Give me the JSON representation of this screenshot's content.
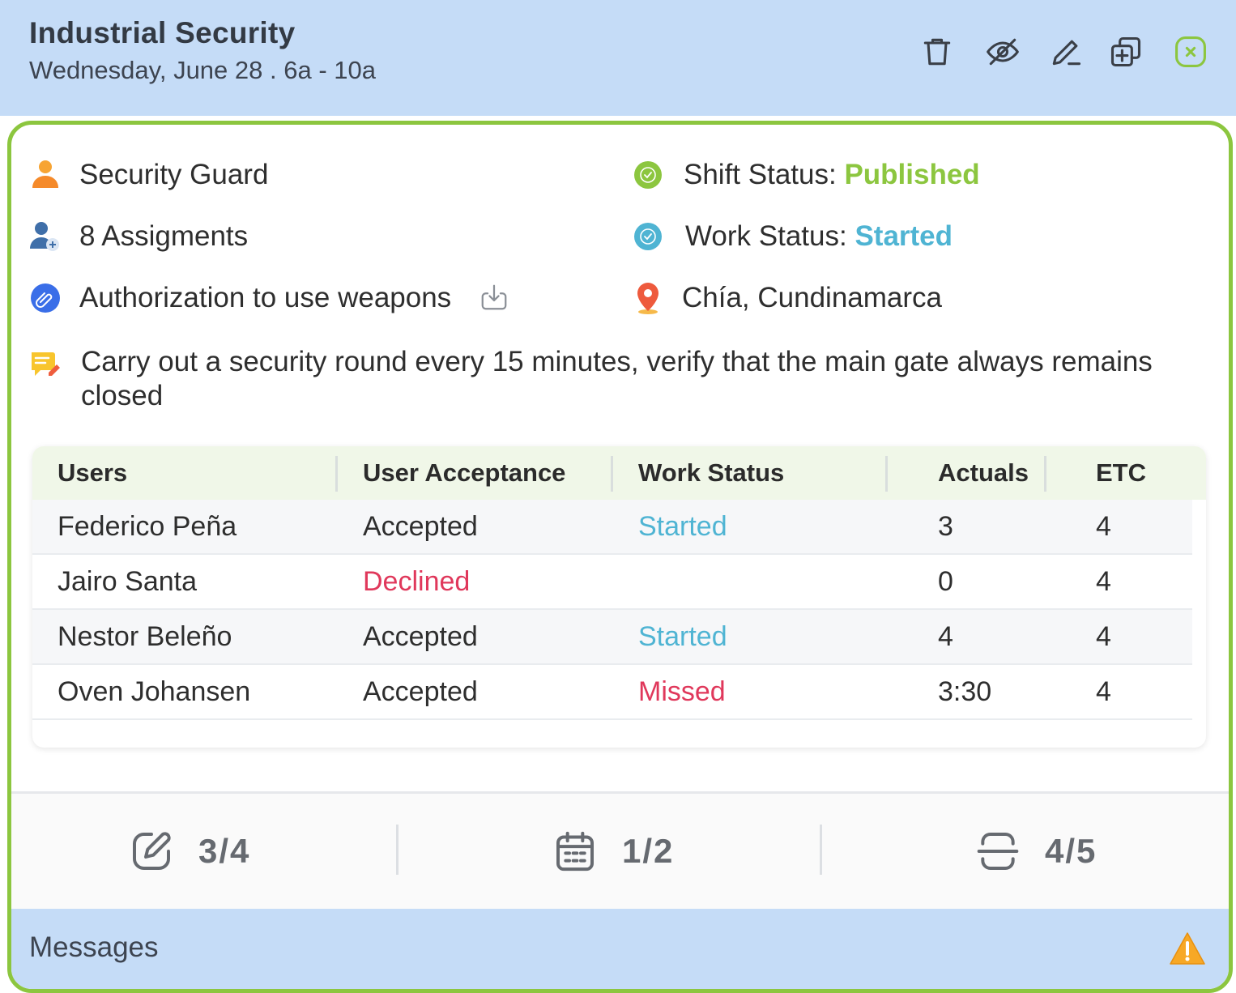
{
  "header": {
    "title": "Industrial Security",
    "subtitle": "Wednesday, June 28 . 6a - 10a",
    "actions": [
      "trash-icon",
      "eye-off-icon",
      "pencil-icon",
      "duplicate-icon",
      "close-icon"
    ]
  },
  "details": {
    "role": "Security Guard",
    "assignments": "8 Assigments",
    "attachment": "Authorization to use weapons",
    "shift_status_label": "Shift Status",
    "shift_status_value": "Published",
    "work_status_label": "Work Status",
    "work_status_value": "Started",
    "location": "Chía, Cundinamarca",
    "note": "Carry out a security round every 15 minutes, verify that the main gate always remains closed"
  },
  "table": {
    "columns": [
      "Users",
      "User Acceptance",
      "Work Status",
      "Actuals",
      "ETC"
    ],
    "rows": [
      {
        "user": "Federico Peña",
        "acceptance": "Accepted",
        "work_status": "Started",
        "actuals": "3",
        "etc": "4"
      },
      {
        "user": "Jairo Santa",
        "acceptance": "Declined",
        "work_status": "",
        "actuals": "0",
        "etc": "4"
      },
      {
        "user": "Nestor Beleño",
        "acceptance": "Accepted",
        "work_status": "Started",
        "actuals": "4",
        "etc": "4"
      },
      {
        "user": "Oven Johansen",
        "acceptance": "Accepted",
        "work_status": "Missed",
        "actuals": "3:30",
        "etc": "4"
      }
    ]
  },
  "stats": {
    "edits": "3/4",
    "schedule": "1/2",
    "scans": "4/5"
  },
  "messages": {
    "label": "Messages"
  },
  "colors": {
    "header_bg": "#c5dcf7",
    "accent_green": "#8cc63f",
    "status_blue": "#4fb4d3",
    "status_red": "#e0385b"
  }
}
